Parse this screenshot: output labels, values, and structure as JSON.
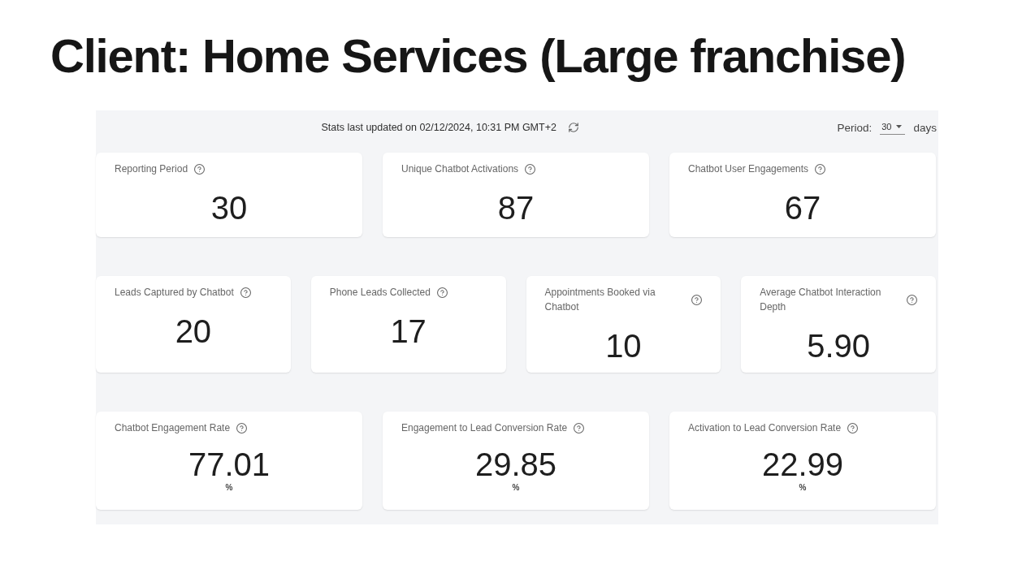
{
  "title": "Client: Home Services (Large franchise)",
  "dashboard": {
    "status": "Stats last updated on 02/12/2024, 10:31 PM GMT+2",
    "period": {
      "label": "Period:",
      "value": "30",
      "unit": "days"
    },
    "rows": [
      {
        "cards": [
          {
            "label": "Reporting Period",
            "value": "30"
          },
          {
            "label": "Unique Chatbot Activations",
            "value": "87"
          },
          {
            "label": "Chatbot User Engagements",
            "value": "67"
          }
        ]
      },
      {
        "cards": [
          {
            "label": "Leads Captured by Chatbot",
            "value": "20"
          },
          {
            "label": "Phone Leads Collected",
            "value": "17"
          },
          {
            "label": "Appointments Booked via Chatbot",
            "value": "10"
          },
          {
            "label": "Average Chatbot Interaction Depth",
            "value": "5.90"
          }
        ]
      },
      {
        "cards": [
          {
            "label": "Chatbot Engagement Rate",
            "value": "77.01",
            "unit": "%"
          },
          {
            "label": "Engagement to Lead Conversion Rate",
            "value": "29.85",
            "unit": "%"
          },
          {
            "label": "Activation to Lead Conversion Rate",
            "value": "22.99",
            "unit": "%"
          }
        ]
      }
    ]
  }
}
